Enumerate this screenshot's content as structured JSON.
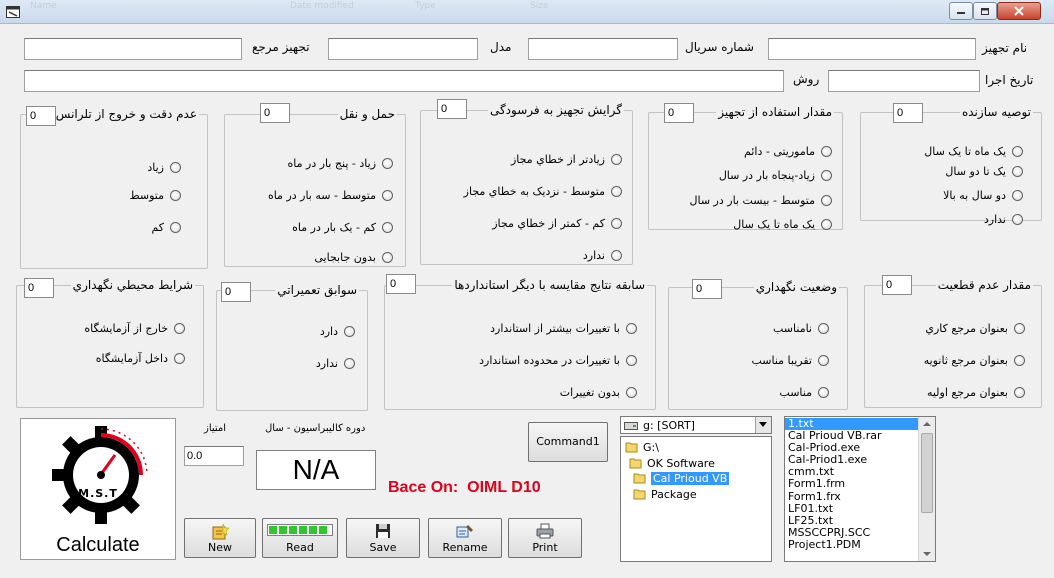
{
  "window": {
    "ghost_columns": [
      "Name",
      "Date modified",
      "Type",
      "Size"
    ]
  },
  "fields": {
    "equipment_name": {
      "label": "نام تجهیز",
      "value": ""
    },
    "serial_number": {
      "label": "شماره سریال",
      "value": ""
    },
    "model": {
      "label": "مدل",
      "value": ""
    },
    "reference_equipment": {
      "label": "تجهیز مرجع",
      "value": ""
    },
    "execution_date": {
      "label": "تاریخ اجرا",
      "value": ""
    },
    "method": {
      "label": "روش",
      "value": ""
    }
  },
  "groups": {
    "manufacturer_recommendation": {
      "title": "توصیه سازنده",
      "score": "0",
      "options": [
        "یک ماه تا یک سال",
        "یک تا دو سال",
        "دو سال به بالا",
        "ندارد"
      ]
    },
    "usage_amount": {
      "title": "مقدار استفاده از تجهیز",
      "score": "0",
      "options": [
        "ماموریتی - دائم",
        "زیاد-پنجاه بار در سال",
        "متوسط - بیست بار در سال",
        "یک ماه تا یک سال"
      ]
    },
    "error_trend": {
      "title": "گرایش تجهیز به فرسودگی",
      "score": "0",
      "options": [
        "زیادتر از خطاي مجاز",
        "متوسط - نزدیک به خطاي مجاز",
        "کم - کمتر از خطاي مجاز",
        "ندارد"
      ]
    },
    "transport": {
      "title": "حمل و نقل",
      "score": "0",
      "options": [
        "زیاد - پنج بار در ماه",
        "متوسط - سه بار در ماه",
        "کم - یک بار در ماه",
        "بدون جابجایی"
      ]
    },
    "tolerance": {
      "title": "عدم دقت و خروج از تلرانس",
      "score": "0",
      "options": [
        "زیاد",
        "متوسط",
        "کم"
      ]
    },
    "uncertainty": {
      "title": "مقدار عدم قطعیت",
      "score": "0",
      "options": [
        "بعنوان مرجع کاري",
        "بعنوان مرجع ثانویه",
        "بعنوان مرجع اولیه"
      ]
    },
    "storage_status": {
      "title": "وضعیت نگهداري",
      "score": "0",
      "options": [
        "نامناسب",
        "تقریبا مناسب",
        "مناسب"
      ]
    },
    "comparison_history": {
      "title": "سابقه نتایج مقایسه با دیگر استانداردها",
      "score": "0",
      "options": [
        "با تغییرات بیشتر از استاندارد",
        "با تغییرات در محدوده استاندارد",
        "بدون تغییرات"
      ]
    },
    "repair_history": {
      "title": "سوابق تعمیراتي",
      "score": "0",
      "options": [
        "دارد",
        "ندارد"
      ]
    },
    "storage_environment": {
      "title": "شرایط محیطي نگهداري",
      "score": "0",
      "options": [
        "خارج از آزمایشگاه",
        "داخل آزمایشگاه"
      ]
    }
  },
  "logo": {
    "text": "M.S.T",
    "caption": "Calculate"
  },
  "score_label": "امتیاز",
  "score_value": "0.0",
  "period_label": "دوره کالیبراسیون - سال",
  "period_value": "N/A",
  "base_text": "Bace On:  OIML D10",
  "command_button": "Command1",
  "buttons": {
    "new": "New",
    "read": "Read",
    "save": "Save",
    "rename": "Rename",
    "print": "Print"
  },
  "drive": {
    "selected": "g: [SORT]"
  },
  "folders": [
    "G:\\",
    "OK Software",
    "Cal Prioud VB",
    "Package"
  ],
  "files": [
    "1.txt",
    "Cal Prioud VB.rar",
    "Cal-Priod.exe",
    "Cal-Priod1.exe",
    "cmm.txt",
    "Form1.frm",
    "Form1.frx",
    "LF01.txt",
    "LF25.txt",
    "MSSCCPRJ.SCC",
    "Project1.PDM"
  ],
  "colors": {
    "accent_red": "#e0001b",
    "selection": "#3399ff",
    "progress_green": "#2ec72e"
  }
}
